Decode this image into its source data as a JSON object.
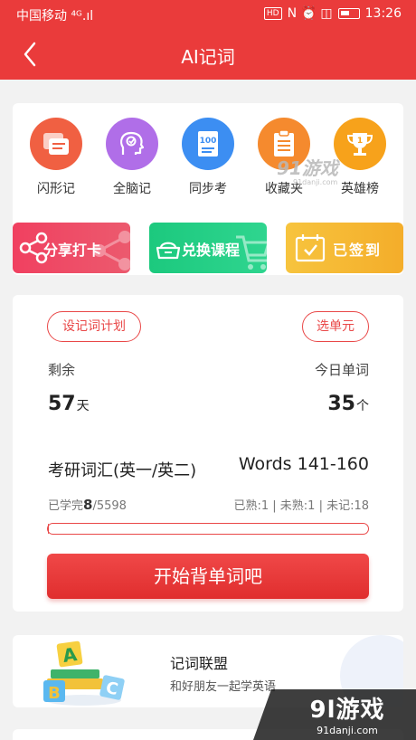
{
  "status_bar": {
    "carrier": "中国移动 ⁴ᴳ.ıl",
    "badge": "HD",
    "icons": "N ⏰ ◫",
    "time": "13:26"
  },
  "nav": {
    "title": "AI记词",
    "back_icon": "chevron-left-icon"
  },
  "menu": [
    {
      "label": "闪形记",
      "icon": "flashcards-icon",
      "color": "#f06042"
    },
    {
      "label": "全脑记",
      "icon": "brain-head-icon",
      "color": "#b06ee8"
    },
    {
      "label": "同步考",
      "icon": "exam-paper-icon",
      "color": "#3c8ef2"
    },
    {
      "label": "收藏夹",
      "icon": "clipboard-list-icon",
      "color": "#f58a2e"
    },
    {
      "label": "英雄榜",
      "icon": "trophy-icon",
      "color": "#f7a21b"
    }
  ],
  "menu_watermark": {
    "text": "91游戏",
    "sub": "91danji.com"
  },
  "banners": [
    {
      "label": "分享打卡",
      "icon": "share-icon",
      "color": "#ee4455"
    },
    {
      "label": "兑换课程",
      "icon": "cart-icon",
      "color": "#1fcf86"
    },
    {
      "label": "已签到",
      "icon": "calendar-check-icon",
      "color": "#f5b833"
    }
  ],
  "plan": {
    "set_plan_label": "设记词计划",
    "choose_unit_label": "选单元",
    "remaining_label": "剩余",
    "remaining_value": "57",
    "remaining_unit": "天",
    "today_label": "今日单词",
    "today_value": "35",
    "today_unit": "个",
    "book": "考研词汇(英一/英二)",
    "range": "Words 141-160",
    "learned_prefix": "已学完",
    "learned_count": "8",
    "learned_total": "/5598",
    "stats": "已熟:1 | 未熟:1 | 未记:18",
    "progress_fraction": 0.0014,
    "start_label": "开始背单词吧"
  },
  "league": {
    "title": "记词联盟",
    "subtitle": "和好朋友一起学英语",
    "icon": "abc-blocks-icon"
  },
  "watermark": {
    "main": "9l游戏",
    "sub": "91danji.com"
  }
}
